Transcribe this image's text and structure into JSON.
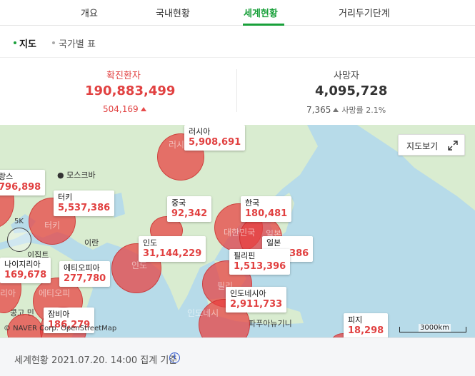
{
  "tabs": [
    {
      "label": "개요"
    },
    {
      "label": "국내현황"
    },
    {
      "label": "세계현황"
    },
    {
      "label": "거리두기단계"
    }
  ],
  "subtabs": [
    {
      "label": "지도"
    },
    {
      "label": "국가별 표"
    }
  ],
  "stats": {
    "confirmed": {
      "label": "확진환자",
      "value": "190,883,499",
      "delta": "504,169"
    },
    "deaths": {
      "label": "사망자",
      "value": "4,095,728",
      "delta": "7,365",
      "rate_label": "사망률 2.1%"
    }
  },
  "map": {
    "view_button": "지도보기",
    "copyright": "© NAVER Corp. OpenStreetMap",
    "scale": "3000km",
    "countries": [
      {
        "name": "러시아",
        "value": "5,908,691"
      },
      {
        "name": "랑스",
        "value": "796,898"
      },
      {
        "name": "터키",
        "value": "5,537,386"
      },
      {
        "name": "중국",
        "value": "92,342"
      },
      {
        "name": "한국",
        "value": "180,481"
      },
      {
        "name": "인도",
        "value": "31,144,229"
      },
      {
        "name": "일본",
        "value": "844,386"
      },
      {
        "name": "필리핀",
        "value": "1,513,396"
      },
      {
        "name": "나이지리아",
        "value": "169,678"
      },
      {
        "name": "에티오피아",
        "value": "277,780"
      },
      {
        "name": "인도네시아",
        "value": "2,911,733"
      },
      {
        "name": "잠비아",
        "value": "186,279"
      },
      {
        "name": "피지",
        "value": "18,298"
      }
    ],
    "places": {
      "moscow": "모스크바",
      "iran": "이란",
      "ijipt": "이집트",
      "papua": "파푸아뉴기니",
      "russia_faded": "러시",
      "turkey_faded": "터키",
      "india_faded": "인도",
      "korea_faded": "대한민국",
      "japan_faded": "일본",
      "phil_faded": "필리",
      "indo_faded": "인도네시",
      "ethi_faded": "에티오피",
      "nigeria_faded": "리아",
      "congo": "콩고 민",
      "sk": "5K",
      "fifty": "50"
    }
  },
  "footer": {
    "text": "세계현황 2021.07.20. 14:00 집계 기준",
    "info": "i"
  },
  "colors": {
    "accent": "#19a03a",
    "confirmed": "#e14141",
    "bubble": "#e73f3f",
    "sea": "#b7dbe9",
    "land": "#d9ecd0"
  }
}
